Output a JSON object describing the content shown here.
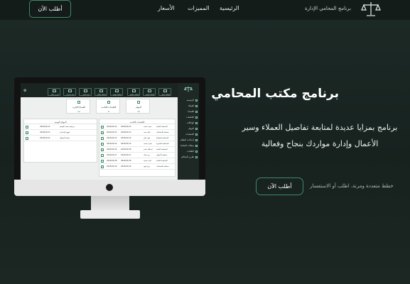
{
  "nav": {
    "cta_label": "أطلب الآن",
    "links": [
      "الرئيسية",
      "المميزات",
      "الأسعار"
    ],
    "brand": "برنامج المحامي الإدارة"
  },
  "hero": {
    "title": "برنامج مكتب المحامي",
    "subtitle": "برنامج بمزايا عديدة لمتابعة تفاصيل العملاء وسير الأعمال وإدارة مواردك بنجاح وفعالية",
    "cta_label": "أطلب الآن",
    "note": "خطط متعددة ومرنة، اطلب أو الاستفسار"
  },
  "app_preview": {
    "sidebar_items": [
      "الرئيسية",
      "العملاء",
      "القضايا",
      "الجلسات",
      "الوكالات",
      "المهام",
      "الحسابات",
      "إعدادات النظام",
      "سجلات النشاط",
      "الطلبات",
      "تقارير المحاكم"
    ],
    "quick_actions": [
      "إضافة عميل",
      "إضافة قضية",
      "إضافة جلسة",
      "إضافة مهمة",
      "إضافة وكالة",
      "سند قبض",
      "سند صرف",
      "تقرير مالي"
    ],
    "stat_cards": [
      {
        "label": "القضايا الجارية",
        "value": "12"
      },
      {
        "label": "الجلسات القادمة",
        "value": "8"
      },
      {
        "label": "المهام",
        "value": "15"
      }
    ],
    "sessions_panel_title": "الجلسات القادمة",
    "tasks_panel_title": "المهام اليومية",
    "session_rows": [
      {
        "client": "محمد أحمد",
        "date": "2024/01/12",
        "court": "المحكمة العامة"
      },
      {
        "client": "خالد سعد",
        "date": "2024/01/13",
        "court": "محكمة الاستئناف"
      },
      {
        "client": "فهد علي",
        "date": "2024/01/14",
        "court": "المحكمة العمالية"
      },
      {
        "client": "سارة محمد",
        "date": "2024/01/15",
        "court": "المحكمة التجارية"
      },
      {
        "client": "عبدالله ناصر",
        "date": "2024/01/16",
        "court": "المحكمة العامة"
      },
      {
        "client": "ريم خالد",
        "date": "2024/01/17",
        "court": "محكمة الأحوال"
      },
      {
        "client": "ماجد سعيد",
        "date": "2024/01/18",
        "court": "المحكمة العامة"
      },
      {
        "client": "نورة فهد",
        "date": "2024/01/19",
        "court": "محكمة الاستئناف"
      }
    ],
    "task_rows": [
      {
        "title": "مراجعة ملف القضية",
        "date": "2024/01/12"
      },
      {
        "title": "تجهيز المذكرة",
        "date": "2024/01/13"
      },
      {
        "title": "متابعة الموكل",
        "date": "2024/01/14"
      }
    ]
  }
}
